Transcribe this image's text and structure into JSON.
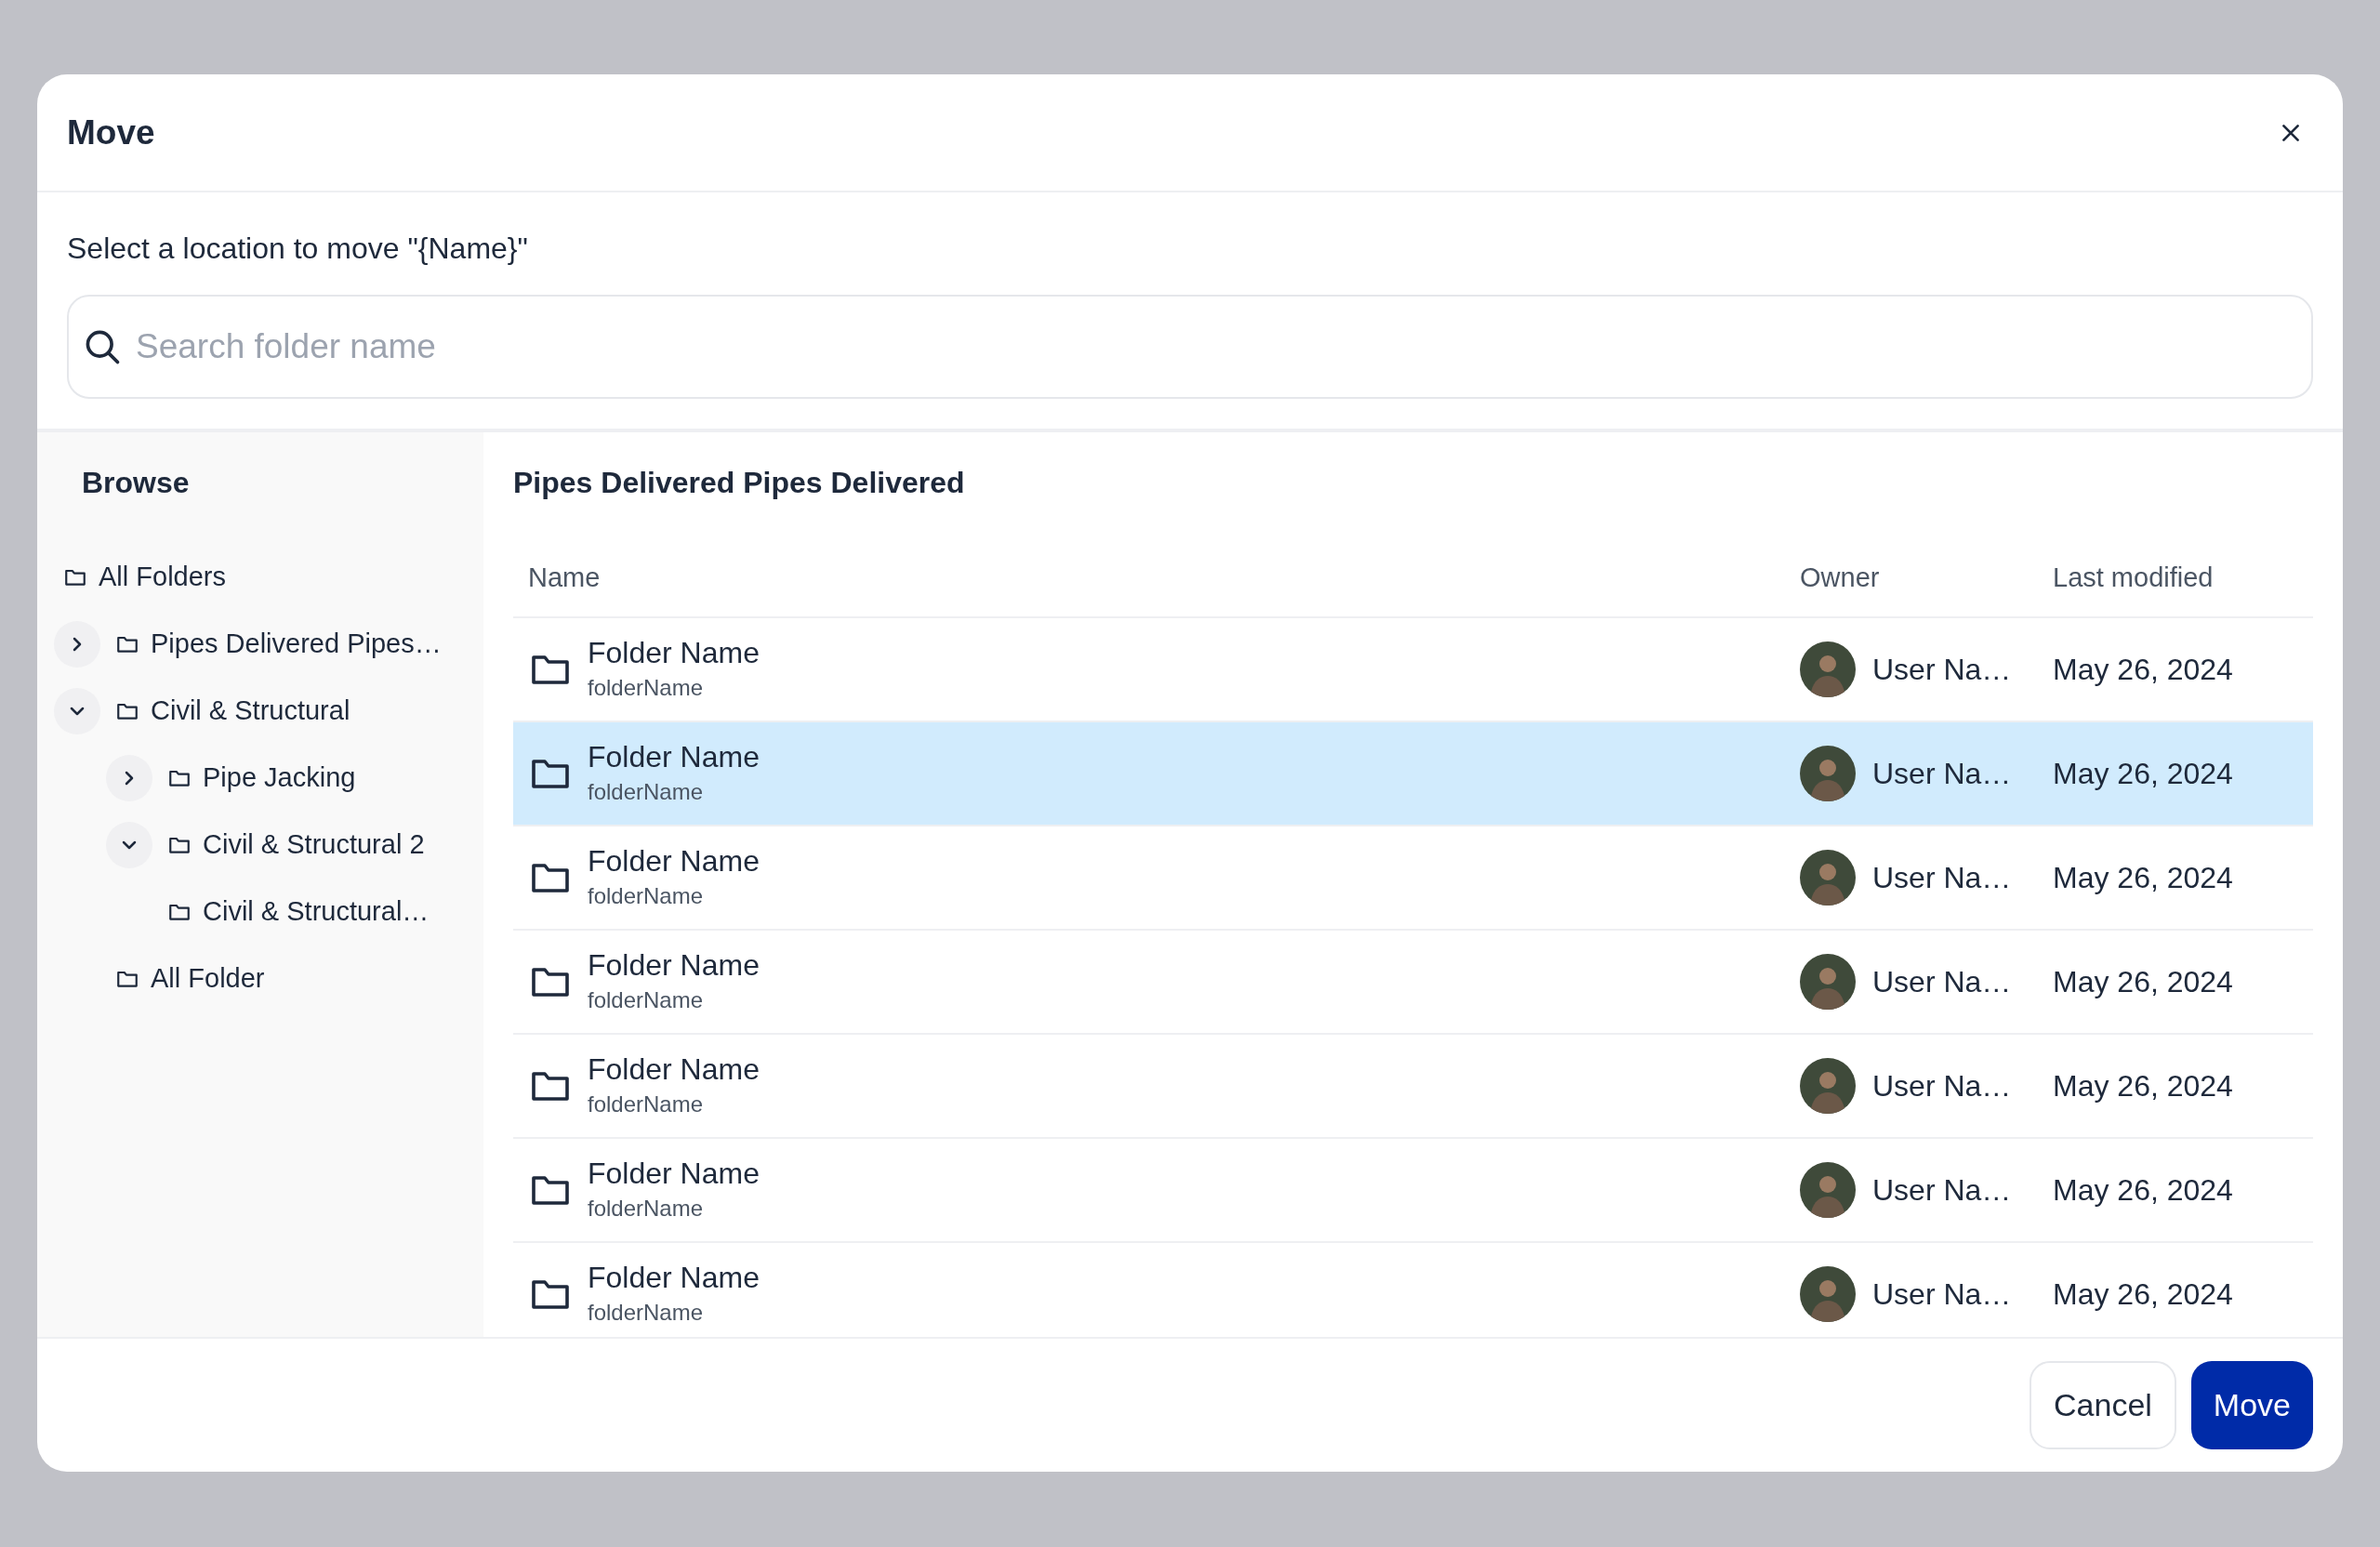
{
  "dialog": {
    "title": "Move",
    "instruction": "Select a location to move \"{Name}\"",
    "search": {
      "placeholder": "Search folder name"
    }
  },
  "sidebar": {
    "title": "Browse",
    "tree": [
      {
        "label": "All Folders",
        "children": [
          {
            "label": "Pipes Delivered Pipes…",
            "expanded": false
          },
          {
            "label": "Civil & Structural",
            "expanded": true,
            "children": [
              {
                "label": "Pipe Jacking",
                "expanded": false
              },
              {
                "label": "Civil & Structural 2",
                "expanded": true
              },
              {
                "label": "Civil & Structural…"
              }
            ]
          },
          {
            "label": "All Folder"
          }
        ]
      }
    ]
  },
  "content": {
    "title": "Pipes Delivered Pipes Delivered",
    "columns": [
      "Name",
      "Owner",
      "Last modified"
    ],
    "rows": [
      {
        "name": "Folder Name",
        "sub": "folderName",
        "owner": "User Na…",
        "modified": "May 26, 2024",
        "selected": false
      },
      {
        "name": "Folder Name",
        "sub": "folderName",
        "owner": "User Na…",
        "modified": "May 26, 2024",
        "selected": true
      },
      {
        "name": "Folder Name",
        "sub": "folderName",
        "owner": "User Na…",
        "modified": "May 26, 2024",
        "selected": false
      },
      {
        "name": "Folder Name",
        "sub": "folderName",
        "owner": "User Na…",
        "modified": "May 26, 2024",
        "selected": false
      },
      {
        "name": "Folder Name",
        "sub": "folderName",
        "owner": "User Na…",
        "modified": "May 26, 2024",
        "selected": false
      },
      {
        "name": "Folder Name",
        "sub": "folderName",
        "owner": "User Na…",
        "modified": "May 26, 2024",
        "selected": false
      },
      {
        "name": "Folder Name",
        "sub": "folderName",
        "owner": "User Na…",
        "modified": "May 26, 2024",
        "selected": false
      }
    ]
  },
  "buttons": [
    {
      "label": "Cancel",
      "kind": "secondary"
    },
    {
      "label": "Move",
      "kind": "primary"
    }
  ]
}
